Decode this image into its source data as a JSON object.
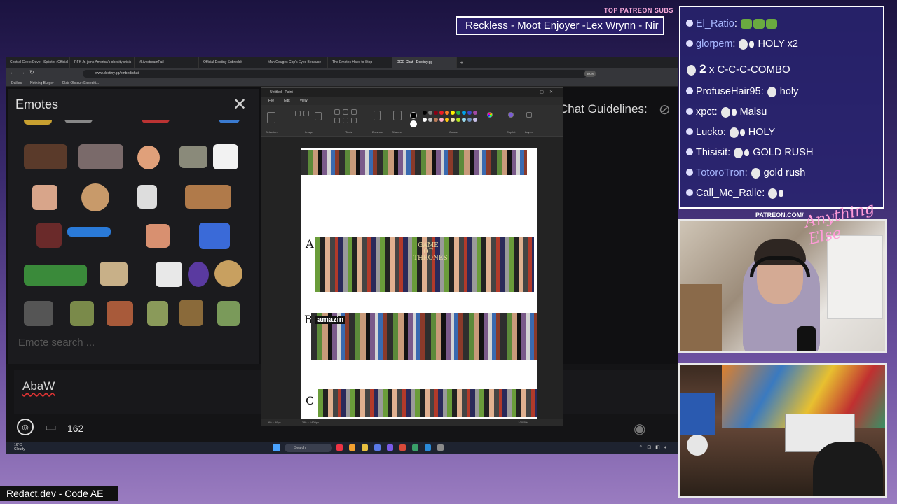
{
  "overlay": {
    "patreon_label": "TOP PATREON SUBS",
    "marquee": "Reckless - Moot Enjoyer -Lex Wrynn - Nir",
    "footer_label": "Redact.dev - Code AE",
    "patreon_tag": "PATREON.COM/",
    "anything_else": "Anything Else"
  },
  "browser": {
    "tabs": [
      "Central Cee x Dave - Splinter (Official Video)",
      "RFK Jr. joins America's obesity crisis",
      "r/LivestreamFail",
      "Official Destiny Subreddit",
      "Man Gouges Cop's Eyes Because",
      "The Emotes Have to Stop",
      "DGG Chat - Destiny.gg"
    ],
    "active_tab": 6,
    "url": "www.destiny.gg/embed/chat",
    "zoom": "300%",
    "bookmarks": [
      "Dailies",
      "Nothing Burger",
      "Clair Obscur: Expediti..."
    ]
  },
  "emotes": {
    "title": "Emotes",
    "search_placeholder": "Emote search ..."
  },
  "chat": {
    "input_value": "AbaW",
    "user_count": "162",
    "guidelines": "Chat Guidelines:"
  },
  "paint": {
    "title": "Untitled - Paint",
    "menu": [
      "File",
      "Edit",
      "View"
    ],
    "ribbon_labels": [
      "Selection",
      "Image",
      "Tools",
      "Brushes",
      "Shapes",
      "Colors",
      "Copilot",
      "Layers"
    ],
    "tiers": [
      "A",
      "B",
      "C"
    ],
    "amazin": "amazin",
    "got": "GAME OF THRONES",
    "status_pos": "69 × 59px",
    "status_size": "780 × 1420px",
    "zoom": "100.5%",
    "swatches": [
      "#000000",
      "#7f7f7f",
      "#880015",
      "#ed1c24",
      "#ff7f27",
      "#fff200",
      "#22b14c",
      "#00a2e8",
      "#3f48cc",
      "#a349a4",
      "#ffffff",
      "#c3c3c3",
      "#b97a57",
      "#ffaec9",
      "#ffc90e",
      "#efe4b0",
      "#b5e61d",
      "#99d9ea",
      "#7092be",
      "#c8bfe7"
    ]
  },
  "taskbar": {
    "weather_temp": "16°C",
    "weather_desc": "Cloudy",
    "search": "Search"
  },
  "side_chat": [
    {
      "name": "El_Ratio",
      "sep": ":",
      "msg": "",
      "emotes": [
        "frog",
        "frog",
        "frog"
      ],
      "name_color": "c2"
    },
    {
      "name": "glorpem",
      "sep": ":",
      "msg": "HOLY x2",
      "emotes": [
        "face",
        "hand"
      ],
      "name_color": "c2"
    },
    {
      "name": "ProfuseHair95",
      "sep": ":",
      "msg": "holy",
      "emotes": [
        "face"
      ],
      "name_color": "c1"
    },
    {
      "name": "xpct",
      "sep": ":",
      "msg": "Malsu",
      "emotes": [
        "face",
        "hand"
      ],
      "name_color": "c1"
    },
    {
      "name": "Lucko",
      "sep": ":",
      "msg": "HOLY",
      "emotes": [
        "face",
        "hand"
      ],
      "name_color": "c1"
    },
    {
      "name": "Thisisit",
      "sep": ":",
      "msg": "GOLD RUSH",
      "emotes": [
        "face",
        "hand"
      ],
      "name_color": "c1"
    },
    {
      "name": "TotoroTron",
      "sep": ":",
      "msg": "gold rush",
      "emotes": [
        "face"
      ],
      "name_color": "c2"
    },
    {
      "name": "Call_Me_Ralle",
      "sep": ":",
      "msg": "",
      "emotes": [
        "face",
        "hand"
      ],
      "name_color": "c1"
    }
  ],
  "combo": {
    "count": "2",
    "x": "x",
    "text": "C-C-C-COMBO"
  },
  "colors": {
    "chat_bg": "#28236e",
    "accent_pink": "#ff9bd8",
    "brand_blue": "#a8b8ff"
  }
}
